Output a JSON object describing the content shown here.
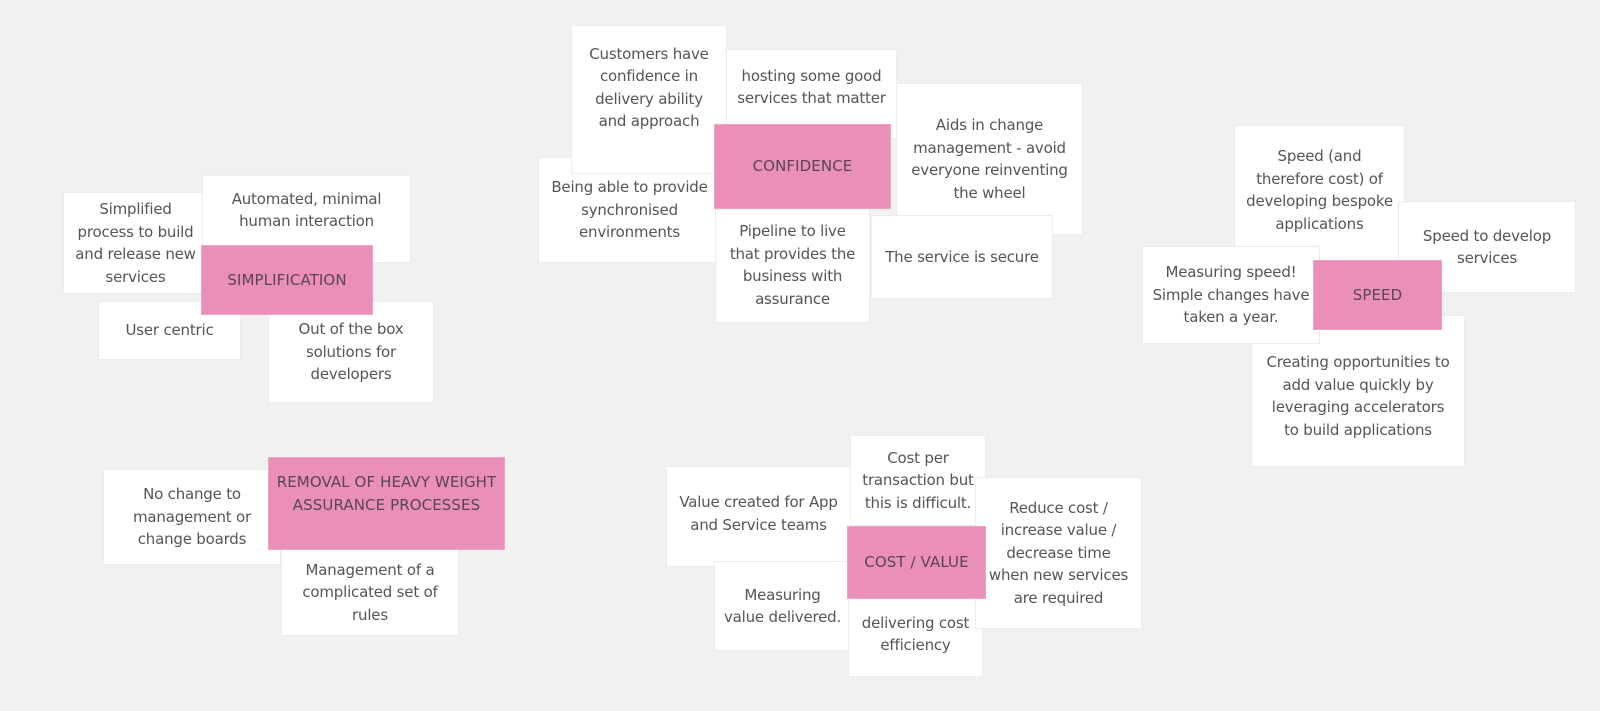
{
  "board": {
    "clusters": [
      {
        "topic": "SIMPLIFICATION",
        "notes": [
          "Simplified\nprocess to build\nand release new\nservices",
          "Automated, minimal\nhuman interaction",
          "User centric",
          "Out of the box\nsolutions for\ndevelopers"
        ]
      },
      {
        "topic": "CONFIDENCE",
        "notes": [
          "Customers have\nconfidence in\ndelivery ability\nand approach",
          "hosting some good\nservices that matter",
          "Being able to provide\nsynchronised\nenvironments",
          "Aids in change\nmanagement - avoid\neveryone reinventing\nthe wheel",
          "Pipeline to live\nthat provides the\nbusiness with\nassurance",
          "The service is secure"
        ]
      },
      {
        "topic": "SPEED",
        "notes": [
          "Speed (and\ntherefore cost) of\ndeveloping bespoke\napplications",
          "Speed to develop\nservices",
          "Measuring speed!\nSimple changes have\ntaken a year.",
          "Creating opportunities to\nadd value quickly by\nleveraging accelerators\nto build applications"
        ]
      },
      {
        "topic": "REMOVAL OF HEAVY WEIGHT\nASSURANCE PROCESSES",
        "notes": [
          "No change to\nmanagement or\nchange boards",
          "Management of a\ncomplicated set of\nrules"
        ]
      },
      {
        "topic": "COST / VALUE",
        "notes": [
          "Value created for App\nand Service teams",
          "Cost per\ntransaction but\nthis is difficult.",
          "Measuring\nvalue delivered.",
          "delivering cost\nefficiency",
          "Reduce cost /\nincrease value /\ndecrease time\nwhen new services\nare required"
        ]
      }
    ]
  },
  "colors": {
    "canvas_background": "#f1f1f1",
    "note_background": "#ffffff",
    "topic_background": "#ea90b8",
    "note_text": "#555555",
    "topic_text": "#5a4452"
  }
}
